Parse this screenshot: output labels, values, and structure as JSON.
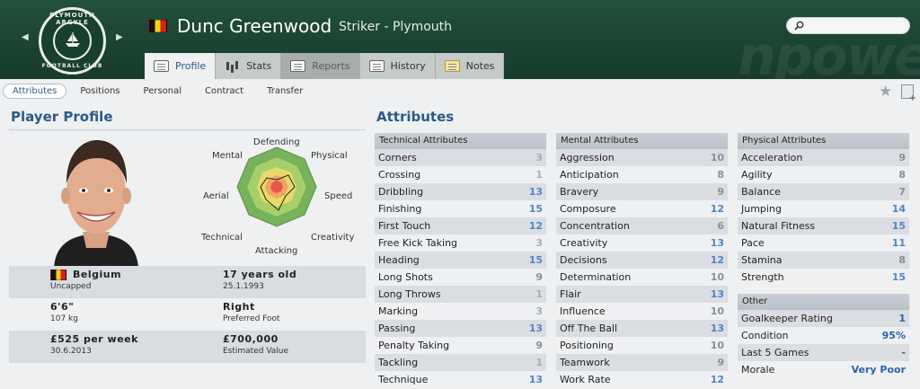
{
  "header": {
    "club_badge": {
      "text_top": "PLYMOUTH ARGYLE",
      "text_bottom": "FOOTBALL CLUB"
    },
    "player_name": "Dunc Greenwood",
    "player_sub": "Striker - Plymouth",
    "watermark": "npowe",
    "flag_colors": [
      "#111111",
      "#f5d312",
      "#d9221c"
    ],
    "tabs": [
      {
        "label": "Profile",
        "icon": "profile-card-icon",
        "state": "active"
      },
      {
        "label": "Stats",
        "icon": "bar-chart-icon",
        "state": "normal"
      },
      {
        "label": "Reports",
        "icon": "report-icon",
        "state": "disabled"
      },
      {
        "label": "History",
        "icon": "history-icon",
        "state": "normal"
      },
      {
        "label": "Notes",
        "icon": "notes-icon",
        "state": "normal"
      }
    ]
  },
  "subnav": {
    "items": [
      "Attributes",
      "Positions",
      "Personal",
      "Contract",
      "Transfer"
    ],
    "active": "Attributes"
  },
  "profile": {
    "title": "Player Profile",
    "radar_labels": {
      "top": "Defending",
      "top_left": "Mental",
      "top_right": "Physical",
      "left": "Aerial",
      "right": "Speed",
      "bottom_left": "Technical",
      "bottom": "Attacking",
      "bottom_right": "Creativity"
    },
    "info": [
      {
        "left_main": "Belgium",
        "left_sub": "Uncapped",
        "right_main": "17 years old",
        "right_sub": "25.1.1993"
      },
      {
        "left_main": "6'6\"",
        "left_sub": "107 kg",
        "right_main": "Right",
        "right_sub": "Preferred Foot"
      },
      {
        "left_main": "£525 per week",
        "left_sub": "30.6.2013",
        "right_main": "£700,000",
        "right_sub": "Estimated Value"
      }
    ]
  },
  "attributes": {
    "title": "Attributes",
    "technical": {
      "header": "Technical Attributes",
      "rows": [
        {
          "name": "Corners",
          "value": "3"
        },
        {
          "name": "Crossing",
          "value": "1"
        },
        {
          "name": "Dribbling",
          "value": "13"
        },
        {
          "name": "Finishing",
          "value": "15"
        },
        {
          "name": "First Touch",
          "value": "12"
        },
        {
          "name": "Free Kick Taking",
          "value": "3"
        },
        {
          "name": "Heading",
          "value": "15"
        },
        {
          "name": "Long Shots",
          "value": "9"
        },
        {
          "name": "Long Throws",
          "value": "1"
        },
        {
          "name": "Marking",
          "value": "3"
        },
        {
          "name": "Passing",
          "value": "13"
        },
        {
          "name": "Penalty Taking",
          "value": "9"
        },
        {
          "name": "Tackling",
          "value": "1"
        },
        {
          "name": "Technique",
          "value": "13"
        }
      ]
    },
    "mental": {
      "header": "Mental Attributes",
      "rows": [
        {
          "name": "Aggression",
          "value": "10"
        },
        {
          "name": "Anticipation",
          "value": "8"
        },
        {
          "name": "Bravery",
          "value": "9"
        },
        {
          "name": "Composure",
          "value": "12"
        },
        {
          "name": "Concentration",
          "value": "6"
        },
        {
          "name": "Creativity",
          "value": "13"
        },
        {
          "name": "Decisions",
          "value": "12"
        },
        {
          "name": "Determination",
          "value": "10"
        },
        {
          "name": "Flair",
          "value": "13"
        },
        {
          "name": "Influence",
          "value": "10"
        },
        {
          "name": "Off The Ball",
          "value": "13"
        },
        {
          "name": "Positioning",
          "value": "10"
        },
        {
          "name": "Teamwork",
          "value": "9"
        },
        {
          "name": "Work Rate",
          "value": "12"
        }
      ]
    },
    "physical": {
      "header": "Physical Attributes",
      "rows": [
        {
          "name": "Acceleration",
          "value": "9"
        },
        {
          "name": "Agility",
          "value": "8"
        },
        {
          "name": "Balance",
          "value": "7"
        },
        {
          "name": "Jumping",
          "value": "14"
        },
        {
          "name": "Natural Fitness",
          "value": "15"
        },
        {
          "name": "Pace",
          "value": "11"
        },
        {
          "name": "Stamina",
          "value": "8"
        },
        {
          "name": "Strength",
          "value": "15"
        }
      ]
    },
    "other": {
      "header": "Other",
      "rows": [
        {
          "name": "Goalkeeper Rating",
          "value": "1"
        },
        {
          "name": "Condition",
          "value": "95%"
        },
        {
          "name": "Last 5 Games",
          "value": "-"
        },
        {
          "name": "Morale",
          "value": "Very Poor"
        }
      ]
    }
  }
}
